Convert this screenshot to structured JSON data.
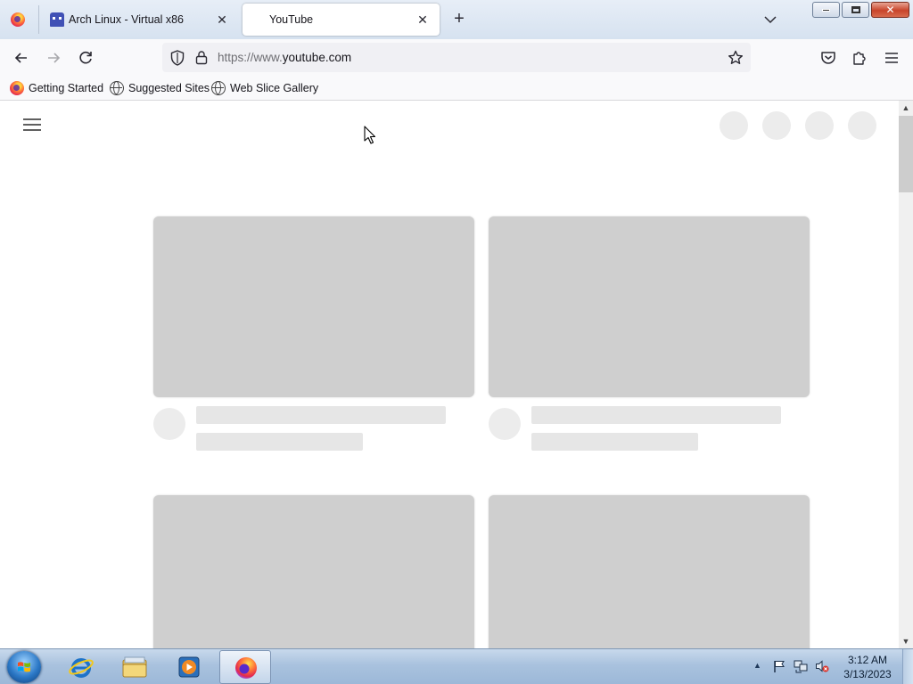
{
  "browser": {
    "tabs": [
      {
        "title": "Arch Linux - Virtual x86",
        "active": false,
        "favicon": "space-invader-icon"
      },
      {
        "title": "YouTube",
        "active": true,
        "favicon": "none"
      }
    ],
    "new_tab_symbol": "+",
    "close_symbol": "✕",
    "url": {
      "prefix": "https://www.",
      "domain": "youtube.com"
    },
    "bookmarks": [
      {
        "label": "Getting Started",
        "icon": "firefox-icon"
      },
      {
        "label": "Suggested Sites",
        "icon": "globe-icon"
      },
      {
        "label": "Web Slice Gallery",
        "icon": "globe-icon"
      }
    ]
  },
  "page": {
    "state": "loading-skeleton",
    "header_icons": [
      "hamburger-menu-icon",
      "placeholder-circle",
      "placeholder-circle",
      "placeholder-circle",
      "placeholder-circle"
    ]
  },
  "taskbar": {
    "pinned": [
      "internet-explorer-icon",
      "windows-explorer-icon",
      "media-player-icon",
      "firefox-icon"
    ],
    "tray": [
      "action-center-flag-icon",
      "network-icon",
      "volume-muted-icon"
    ],
    "time": "3:12 AM",
    "date": "3/13/2023"
  },
  "colors": {
    "skeleton_thumb": "#cfcfcf",
    "skeleton_line": "#e6e6e6",
    "toolbar": "#f9f9fb",
    "urlbar": "#f0f0f4"
  }
}
